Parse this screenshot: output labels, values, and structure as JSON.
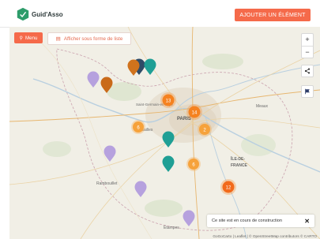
{
  "header": {
    "logo_text": "Guid'Asso",
    "add_button": "AJOUTER UN ÉLÉMENT"
  },
  "controls": {
    "menu": "Menu",
    "list_view": "Afficher sous forme de liste"
  },
  "map": {
    "zoom_in": "+",
    "zoom_out": "−",
    "city_labels": [
      "PARIS",
      "ÎLE-DE-",
      "FRANCE",
      "Saint-Germain-en-Laye",
      "Versailles",
      "Rambouillet",
      "Meaux",
      "Étampes"
    ],
    "clusters": [
      "13",
      "14",
      "6",
      "2",
      "6",
      "12"
    ],
    "notice": "Ce site est en cours de construction",
    "attribution": "GoGoCarto | Leaflet | © OpenStreetMap contributors © CARTO"
  },
  "colors": {
    "accent": "#f56a4a",
    "cluster": "#f7923a",
    "marker_purple": "#b6a1de",
    "marker_teal": "#1f9f95",
    "marker_orange": "#d0731d",
    "marker_navy": "#2f4b67"
  }
}
